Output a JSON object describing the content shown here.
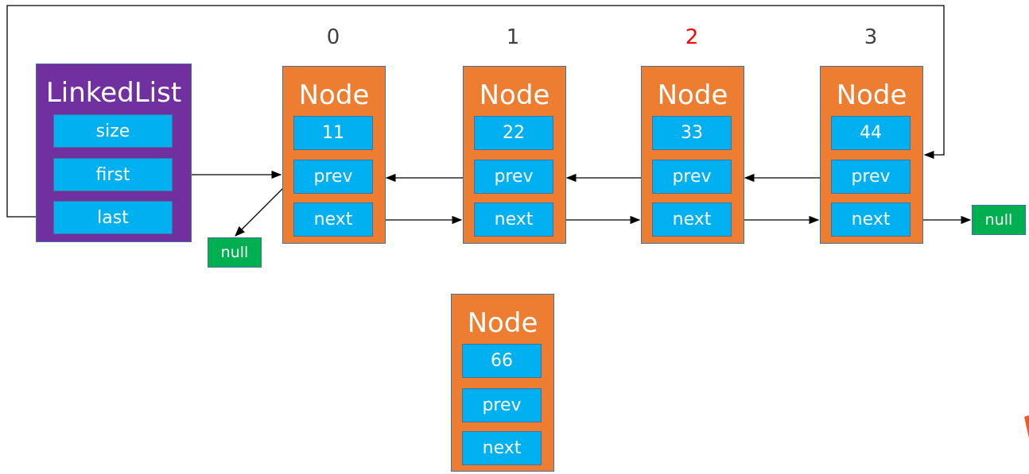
{
  "linked_list": {
    "title": "LinkedList",
    "fields": [
      "size",
      "first",
      "last"
    ],
    "color": "#7030a0"
  },
  "indices": [
    {
      "label": "0",
      "color": "#404040"
    },
    {
      "label": "1",
      "color": "#404040"
    },
    {
      "label": "2",
      "color": "#ff0000"
    },
    {
      "label": "3",
      "color": "#404040"
    }
  ],
  "nodes": [
    {
      "title": "Node",
      "value": "11",
      "prev": "prev",
      "next": "next"
    },
    {
      "title": "Node",
      "value": "22",
      "prev": "prev",
      "next": "next"
    },
    {
      "title": "Node",
      "value": "33",
      "prev": "prev",
      "next": "next"
    },
    {
      "title": "Node",
      "value": "44",
      "prev": "prev",
      "next": "next"
    }
  ],
  "new_node": {
    "title": "Node",
    "value": "66",
    "prev": "prev",
    "next": "next"
  },
  "nulls": [
    "null",
    "null"
  ],
  "colors": {
    "node": "#ed7d31",
    "field": "#00b0f0",
    "null": "#00b050"
  }
}
